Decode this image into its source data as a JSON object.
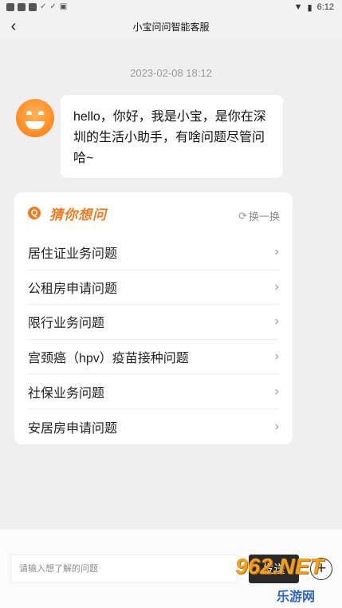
{
  "status_bar": {
    "time": "6:12",
    "left_icons": [
      "notification-icon",
      "notification-icon",
      "notification-icon",
      "check-icon",
      "check-icon",
      "app-icon"
    ],
    "right_icons": [
      "wifi-icon",
      "battery-icon"
    ]
  },
  "nav": {
    "title": "小宝问问智能客服",
    "back_glyph": "‹"
  },
  "chat": {
    "timestamp": "2023-02-08 18:12",
    "bot_message": "hello，你好，我是小宝，是你在深圳的生活小助手，有啥问题尽管问哈~"
  },
  "suggestions": {
    "title": "猜你想问",
    "refresh_label": "换一换",
    "items": [
      {
        "label": "居住证业务问题"
      },
      {
        "label": "公租房申请问题"
      },
      {
        "label": "限行业务问题"
      },
      {
        "label": "宫颈癌（hpv）疫苗接种问题"
      },
      {
        "label": "社保业务问题"
      },
      {
        "label": "安居房申请问题"
      }
    ]
  },
  "composer": {
    "placeholder": "请输入想了解的问题",
    "value": "",
    "send_label": "发送"
  },
  "watermark": {
    "main": "962.NET",
    "sub": "乐游网"
  },
  "colors": {
    "accent": "#f07a1e",
    "background": "#efefef",
    "send_button": "#2a2a2a"
  }
}
